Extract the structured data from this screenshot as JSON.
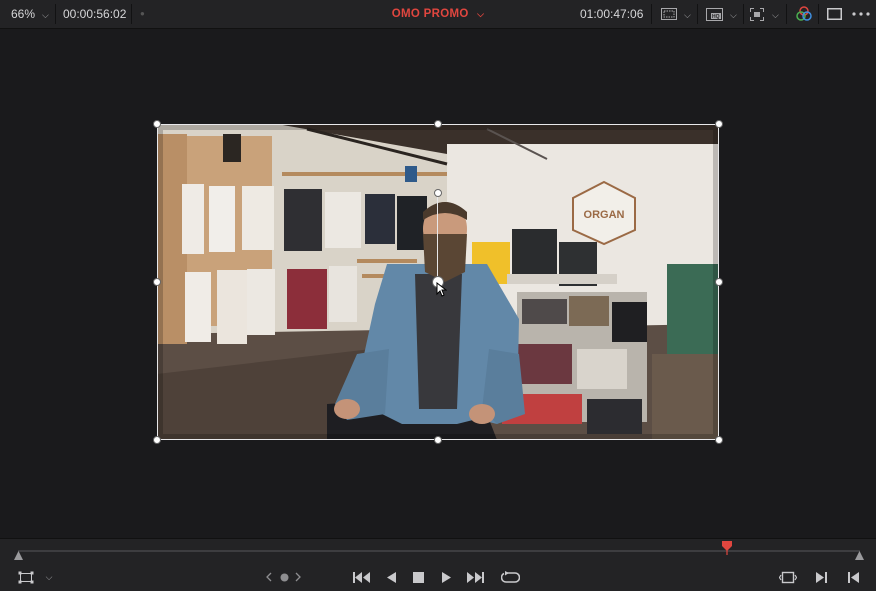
{
  "viewer": {
    "zoom_level": "66%",
    "source_timecode": "00:00:56:02",
    "timeline_name": "OMO PROMO",
    "record_timecode": "01:00:47:06"
  },
  "colors": {
    "accent_red": "#e0463f",
    "panel": "#232325",
    "background": "#1a1a1c"
  },
  "icons": {
    "topbar": [
      "chevron-down-icon",
      "dot-icon",
      "safe-area-icon",
      "hq-display-icon",
      "focus-overlay-icon",
      "color-wheel-icon",
      "single-viewer-icon",
      "more-options-icon"
    ],
    "bottombar": [
      "transform-icon",
      "jog-left-icon",
      "jog-right-icon",
      "jump-to-start-icon",
      "play-reverse-icon",
      "stop-icon",
      "play-icon",
      "jump-to-end-icon",
      "loop-icon",
      "match-frame-icon",
      "next-edit-icon",
      "prev-edit-icon"
    ]
  },
  "video": {
    "sign_text": "ORGAN"
  },
  "scrubber": {
    "playhead_fraction": 0.842
  }
}
